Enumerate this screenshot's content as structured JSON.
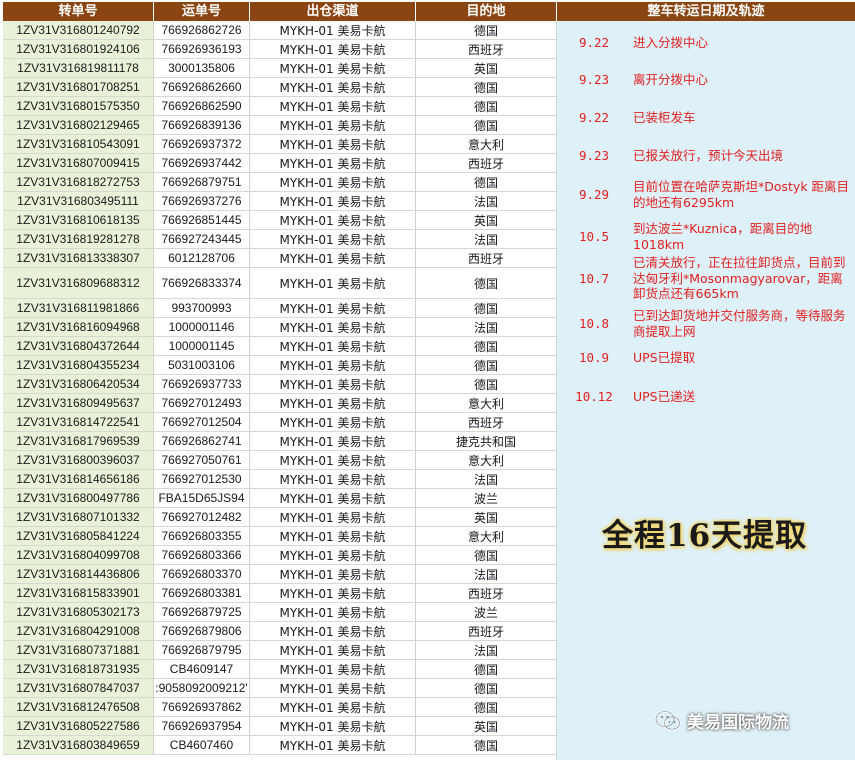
{
  "headers": [
    "转单号",
    "运单号",
    "出仓渠道",
    "目的地",
    "整车转运日期及轨迹"
  ],
  "rows": [
    [
      "1ZV31V316801240792",
      "766926862726",
      "MYKH-01 美易卡航",
      "德国"
    ],
    [
      "1ZV31V316801924106",
      "766926936193",
      "MYKH-01 美易卡航",
      "西班牙"
    ],
    [
      "1ZV31V316819811178",
      "3000135806",
      "MYKH-01 美易卡航",
      "英国"
    ],
    [
      "1ZV31V316801708251",
      "766926862660",
      "MYKH-01 美易卡航",
      "德国"
    ],
    [
      "1ZV31V316801575350",
      "766926862590",
      "MYKH-01 美易卡航",
      "德国"
    ],
    [
      "1ZV31V316802129465",
      "766926839136",
      "MYKH-01 美易卡航",
      "德国"
    ],
    [
      "1ZV31V316810543091",
      "766926937372",
      "MYKH-01 美易卡航",
      "意大利"
    ],
    [
      "1ZV31V316807009415",
      "766926937442",
      "MYKH-01 美易卡航",
      "西班牙"
    ],
    [
      "1ZV31V316818272753",
      "766926879751",
      "MYKH-01 美易卡航",
      "德国"
    ],
    [
      "1ZV31V316803495111",
      "766926937276",
      "MYKH-01 美易卡航",
      "法国"
    ],
    [
      "1ZV31V316810618135",
      "766926851445",
      "MYKH-01 美易卡航",
      "英国"
    ],
    [
      "1ZV31V316819281278",
      "766927243445",
      "MYKH-01 美易卡航",
      "法国"
    ],
    [
      "1ZV31V316813338307",
      "6012128706",
      "MYKH-01 美易卡航",
      "西班牙"
    ],
    [
      "1ZV31V316809688312",
      "766926833374",
      "MYKH-01 美易卡航",
      "德国"
    ],
    [
      "1ZV31V316811981866",
      "993700993",
      "MYKH-01 美易卡航",
      "德国"
    ],
    [
      "1ZV31V316816094968",
      "1000001146",
      "MYKH-01 美易卡航",
      "法国"
    ],
    [
      "1ZV31V316804372644",
      "1000001145",
      "MYKH-01 美易卡航",
      "德国"
    ],
    [
      "1ZV31V316804355234",
      "5031003106",
      "MYKH-01 美易卡航",
      "德国"
    ],
    [
      "1ZV31V316806420534",
      "766926937733",
      "MYKH-01 美易卡航",
      "德国"
    ],
    [
      "1ZV31V316809495637",
      "766927012493",
      "MYKH-01 美易卡航",
      "意大利"
    ],
    [
      "1ZV31V316814722541",
      "766927012504",
      "MYKH-01 美易卡航",
      "西班牙"
    ],
    [
      "1ZV31V316817969539",
      "766926862741",
      "MYKH-01 美易卡航",
      "捷克共和国"
    ],
    [
      "1ZV31V316800396037",
      "766927050761",
      "MYKH-01 美易卡航",
      "意大利"
    ],
    [
      "1ZV31V316814656186",
      "766927012530",
      "MYKH-01 美易卡航",
      "法国"
    ],
    [
      "1ZV31V316800497786",
      "FBA15D65JS94",
      "MYKH-01 美易卡航",
      "波兰"
    ],
    [
      "1ZV31V316807101332",
      "766927012482",
      "MYKH-01 美易卡航",
      "英国"
    ],
    [
      "1ZV31V316805841224",
      "766926803355",
      "MYKH-01 美易卡航",
      "意大利"
    ],
    [
      "1ZV31V316804099708",
      "766926803366",
      "MYKH-01 美易卡航",
      "德国"
    ],
    [
      "1ZV31V316814436806",
      "766926803370",
      "MYKH-01 美易卡航",
      "法国"
    ],
    [
      "1ZV31V316815833901",
      "766926803381",
      "MYKH-01 美易卡航",
      "西班牙"
    ],
    [
      "1ZV31V316805302173",
      "766926879725",
      "MYKH-01 美易卡航",
      "波兰"
    ],
    [
      "1ZV31V316804291008",
      "766926879806",
      "MYKH-01 美易卡航",
      "西班牙"
    ],
    [
      "1ZV31V316807371881",
      "766926879795",
      "MYKH-01 美易卡航",
      "法国"
    ],
    [
      "1ZV31V316818731935",
      "CB4609147",
      "MYKH-01 美易卡航",
      "德国"
    ],
    [
      "1ZV31V316807847037",
      ":9058092009212'",
      "MYKH-01 美易卡航",
      "德国"
    ],
    [
      "1ZV31V316812476508",
      "766926937862",
      "MYKH-01 美易卡航",
      "德国"
    ],
    [
      "1ZV31V316805227586",
      "766926937954",
      "MYKH-01 美易卡航",
      "英国"
    ],
    [
      "1ZV31V316803849659",
      "CB4607460",
      "MYKH-01 美易卡航",
      "德国"
    ]
  ],
  "track": [
    {
      "date": "9.22",
      "text": "进入分拨中心"
    },
    {
      "date": "9.23",
      "text": "离开分拨中心"
    },
    {
      "date": "9.22",
      "text": "已装柜发车"
    },
    {
      "date": "9.23",
      "text": "已报关放行，预计今天出境"
    },
    {
      "date": "9.29",
      "text": "目前位置在哈萨克斯坦*Dostyk 距离目的地还有6295km"
    },
    {
      "date": "10.5",
      "text": "到达波兰*Kuznica，距离目的地1018km"
    },
    {
      "date": "10.7",
      "text": "已清关放行，正在拉往卸货点，目前到达匈牙利*Mosonmagyarovar，距离卸货点还有665km"
    },
    {
      "date": "10.8",
      "text": "已到达卸货地并交付服务商，等待服务商提取上网"
    },
    {
      "date": "10.9",
      "text": "UPS已提取"
    },
    {
      "date": "10.12",
      "text": "UPS已递送"
    }
  ],
  "summary": {
    "prefix": "全程",
    "number": "16",
    "suffix": "天提取"
  },
  "watermark": {
    "label": "美易国际物流",
    "icon": "wechat-icon"
  },
  "colors": {
    "header_bg": "#8b4513",
    "track_bg": "#dff1f8",
    "track_text": "#e02020",
    "first_col_bg": "#e8f2d9"
  }
}
